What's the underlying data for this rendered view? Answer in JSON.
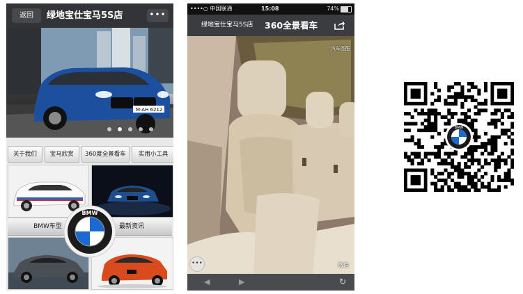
{
  "phone1": {
    "header": {
      "back_label": "返回",
      "title": "绿地宝仕宝马5S店",
      "more_label": "•••"
    },
    "hero": {
      "plate_text": "M·AH 6212",
      "active_dot": 1,
      "dot_count": 5
    },
    "nav": [
      {
        "label": "关于我们"
      },
      {
        "label": "宝马欣赏"
      },
      {
        "label": "360度全景看车"
      },
      {
        "label": "实用小工具"
      }
    ],
    "tiles": [
      {
        "label": "BMW车型"
      },
      {
        "label": "最新资讯"
      }
    ],
    "logo_text": "BMW"
  },
  "phone2": {
    "status": {
      "carrier": "••••○ 中国联通",
      "time": "15:08",
      "battery": "74%"
    },
    "header": {
      "shop_name": "绿地宝仕宝马5S店",
      "title": "360全景看车"
    },
    "brand_watermark": "汽车图酷",
    "weibo_label": "微信",
    "round_button": "•••",
    "nav": {
      "prev": "◀",
      "next": "▶",
      "refresh": "↻"
    }
  },
  "qr": {
    "logo_text": "BMW"
  },
  "colors": {
    "header_dark": "#333437",
    "bmw_blue": "#1c69d4"
  }
}
